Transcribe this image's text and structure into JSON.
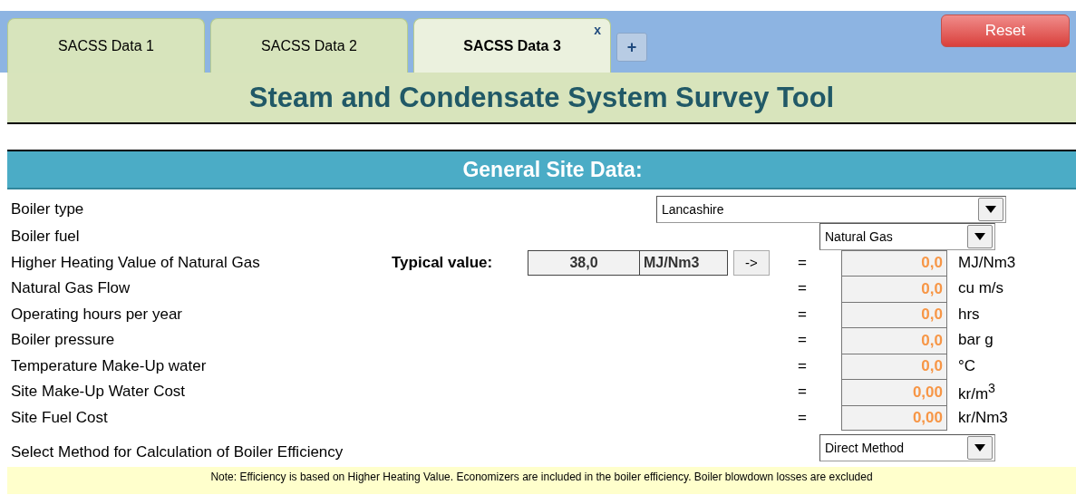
{
  "tabs": [
    {
      "label": "SACSS Data 1",
      "selected": false
    },
    {
      "label": "SACSS Data 2",
      "selected": false
    },
    {
      "label": "SACSS Data 3",
      "selected": true,
      "close": "x"
    }
  ],
  "add_tab": "+",
  "reset_button": "Reset",
  "title": "Steam and Condensate System Survey Tool",
  "section_header": "General Site Data:",
  "fields": [
    {
      "kind": "wide-select",
      "label": "Boiler type",
      "value": "Lancashire"
    },
    {
      "kind": "select",
      "label": "Boiler fuel",
      "value": "Natural Gas"
    },
    {
      "kind": "input",
      "label": "Higher Heating Value of Natural Gas",
      "typical": {
        "label": "Typical value:",
        "value": "38,0",
        "unit": "MJ/Nm3",
        "button": "->"
      },
      "equals": "=",
      "value": "0,0",
      "unit": "MJ/Nm3"
    },
    {
      "kind": "input",
      "label": "Natural Gas Flow",
      "equals": "=",
      "value": "0,0",
      "unit": "cu m/s"
    },
    {
      "kind": "input",
      "label": "Operating hours per year",
      "equals": "=",
      "value": "0,0",
      "unit": "hrs"
    },
    {
      "kind": "input",
      "label": "Boiler pressure",
      "equals": "=",
      "value": "0,0",
      "unit": "bar g"
    },
    {
      "kind": "input",
      "label": "Temperature Make-Up water",
      "equals": "=",
      "value": "0,0",
      "unit": "°C"
    },
    {
      "kind": "input",
      "label": "Site Make-Up Water Cost",
      "equals": "=",
      "value": "0,00",
      "unit": "kr/m$^{3}$"
    },
    {
      "kind": "input",
      "label": "Site Fuel Cost",
      "equals": "=",
      "value": "0,00",
      "unit": "kr/Nm3"
    },
    {
      "kind": "select",
      "label": "Select Method for Calculation of Boiler Efficiency",
      "value": "Direct Method"
    }
  ],
  "note": "Note: Efficiency is based on Higher Heating Value.  Economizers are included in the boiler efficiency.  Boiler blowdown losses are excluded"
}
